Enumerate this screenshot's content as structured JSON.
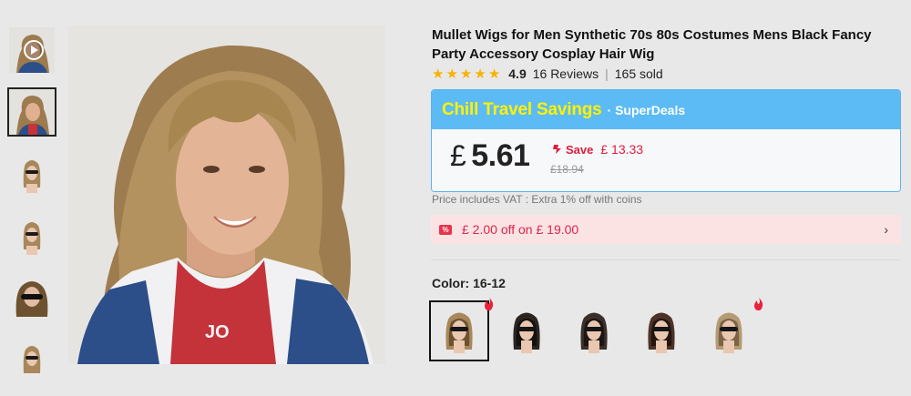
{
  "product": {
    "title": "Mullet Wigs for Men Synthetic 70s 80s Costumes Mens Black Fancy Party Accessory Cosplay Hair Wig",
    "rating": "4.9",
    "reviews": "16 Reviews",
    "sold": "165 sold",
    "star_count": 5
  },
  "deal": {
    "title": "Chill Travel Savings",
    "subtitle": "· SuperDeals",
    "currency": "£",
    "price": "5.61",
    "save_label": "Save",
    "save_amount": "£ 13.33",
    "original_price": "£18.94"
  },
  "vat_note": "Price includes VAT : Extra 1% off with coins",
  "coupon": {
    "text": "£ 2.00 off on  £ 19.00",
    "icon": "%"
  },
  "color": {
    "label": "Color:",
    "value": "16-12",
    "options": [
      {
        "name": "16-12",
        "selected": true,
        "hot": true,
        "hair": "#a8875a",
        "dark": "#6e5230"
      },
      {
        "name": "black",
        "selected": false,
        "hot": false,
        "hair": "#2b2521",
        "dark": "#141110"
      },
      {
        "name": "black-2",
        "selected": false,
        "hot": false,
        "hair": "#3a302a",
        "dark": "#1b1613"
      },
      {
        "name": "dark-brown",
        "selected": false,
        "hot": false,
        "hair": "#4d3228",
        "dark": "#24150f"
      },
      {
        "name": "blonde",
        "selected": false,
        "hot": true,
        "hair": "#b59b73",
        "dark": "#7d6446"
      }
    ]
  },
  "thumbnails": [
    {
      "kind": "video",
      "selected": false
    },
    {
      "kind": "photo",
      "selected": true
    },
    {
      "kind": "wig",
      "selected": false
    },
    {
      "kind": "wig",
      "selected": false
    },
    {
      "kind": "wig-dark",
      "selected": false
    },
    {
      "kind": "wig",
      "selected": false
    }
  ],
  "colors": {
    "accent_blue": "#5cbbf5",
    "deal_title": "#fff200",
    "sale_red": "#e11c3c",
    "star": "#f9b200"
  }
}
